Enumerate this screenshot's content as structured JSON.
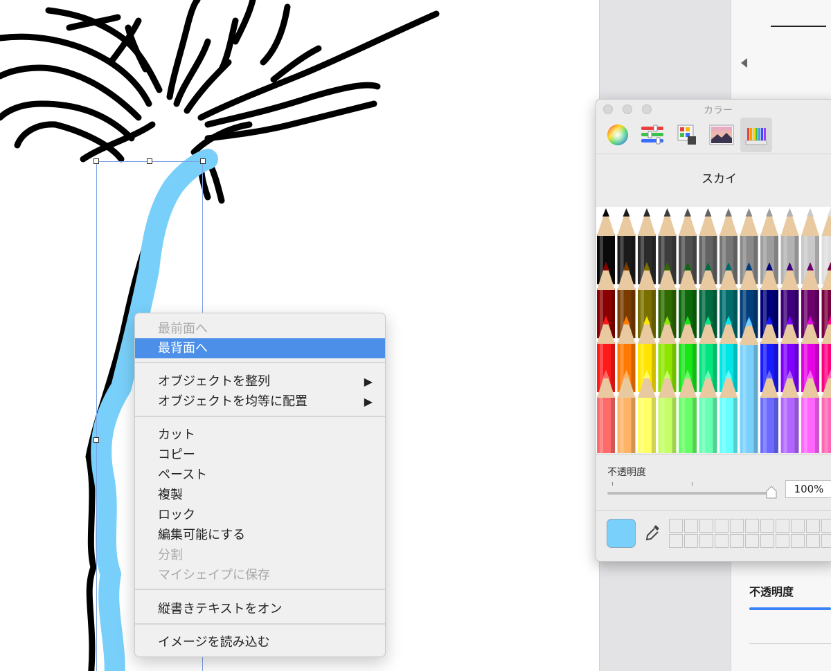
{
  "context_menu": {
    "items": [
      {
        "label": "最前面へ",
        "disabled": true
      },
      {
        "label": "最背面へ",
        "highlighted": true
      },
      {
        "label": "オブジェクトを整列",
        "submenu": true
      },
      {
        "label": "オブジェクトを均等に配置",
        "submenu": true
      },
      {
        "label": "カット"
      },
      {
        "label": "コピー"
      },
      {
        "label": "ペースト"
      },
      {
        "label": "複製"
      },
      {
        "label": "ロック"
      },
      {
        "label": "編集可能にする"
      },
      {
        "label": "分割",
        "disabled": true
      },
      {
        "label": "マイシェイプに保存",
        "disabled": true
      },
      {
        "label": "縦書きテキストをオン"
      },
      {
        "label": "イメージを読み込む"
      }
    ],
    "submenu_arrow": "▶"
  },
  "color_window": {
    "title": "カラー",
    "modes": [
      "color-wheel-icon",
      "sliders-icon",
      "palettes-icon",
      "image-palette-icon",
      "pencils-icon"
    ],
    "active_mode": "pencils-icon",
    "selected_color_name": "スカイ",
    "opacity_label": "不透明度",
    "opacity_value": "100%",
    "opacity_fraction": 1.0,
    "current_color": "#79d0fb",
    "pencil_rows": [
      [
        "#0a0a0a",
        "#1a1a1a",
        "#2b2b2b",
        "#3d3d3d",
        "#505050",
        "#636363",
        "#767676",
        "#8a8a8a",
        "#9e9e9e",
        "#b3b3b3",
        "#c9c9c9",
        "#dedede"
      ],
      [
        "#8b0000",
        "#7a3b00",
        "#7a7000",
        "#2f6b00",
        "#0b6b0b",
        "#006b40",
        "#006b6b",
        "#003d7a",
        "#00007a",
        "#3d007a",
        "#6b006b",
        "#7a0040"
      ],
      [
        "#ff1a1a",
        "#ff7a00",
        "#ffe600",
        "#8ee600",
        "#19e619",
        "#00e680",
        "#00e6e6",
        "#0080ff",
        "#1a1aff",
        "#8000ff",
        "#e600e6",
        "#ff0080"
      ],
      [
        "#ff6b6b",
        "#ffb366",
        "#ffff66",
        "#c4ff66",
        "#66ff66",
        "#66ffb3",
        "#66ffff",
        "#79d0fb",
        "#6b6bff",
        "#b366ff",
        "#ff66ff",
        "#ff66b3"
      ]
    ]
  },
  "right_panel": {
    "opacity_label": "不透明度"
  }
}
